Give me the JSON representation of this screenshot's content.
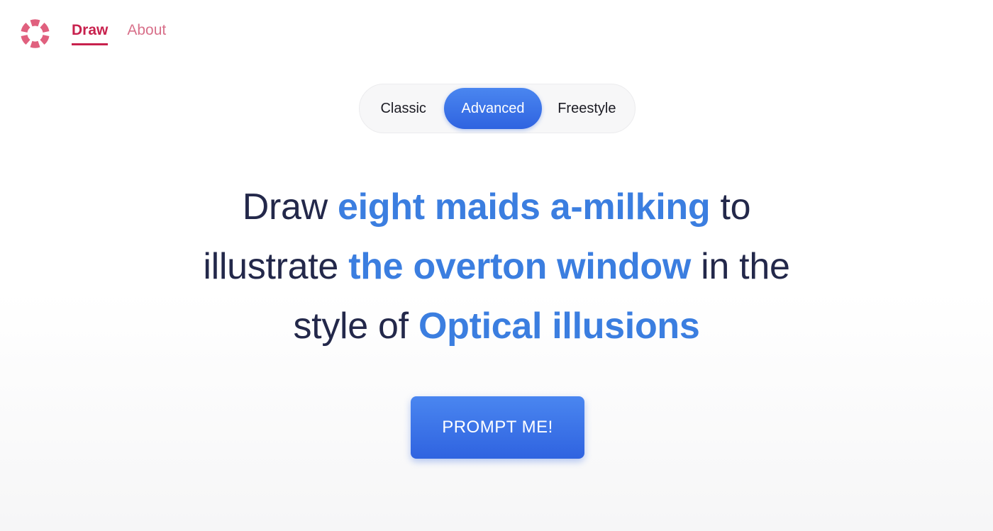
{
  "header": {
    "logo_icon": "lifebuoy-ring-icon",
    "logo_color": "#e0607e",
    "nav": [
      {
        "label": "Draw",
        "active": true
      },
      {
        "label": "About",
        "active": false
      }
    ]
  },
  "mode_selector": {
    "options": [
      "Classic",
      "Advanced",
      "Freestyle"
    ],
    "selected": "Advanced"
  },
  "prompt": {
    "line1": {
      "pre": "Draw ",
      "subject": "eight maids a-milking",
      "post": " to"
    },
    "line2": {
      "pre": "illustrate ",
      "concept": "the overton window",
      "post": " in the"
    },
    "line3": {
      "pre": "style of ",
      "style": "Optical illusions",
      "post": ""
    }
  },
  "actions": {
    "prompt_button_label": "PROMPT ME!"
  },
  "colors": {
    "accent_blue": "#3b7ee0",
    "button_blue": "#2f63e0",
    "nav_active": "#c8214d",
    "nav_inactive": "#d8708a",
    "text_dark": "#23284a"
  }
}
